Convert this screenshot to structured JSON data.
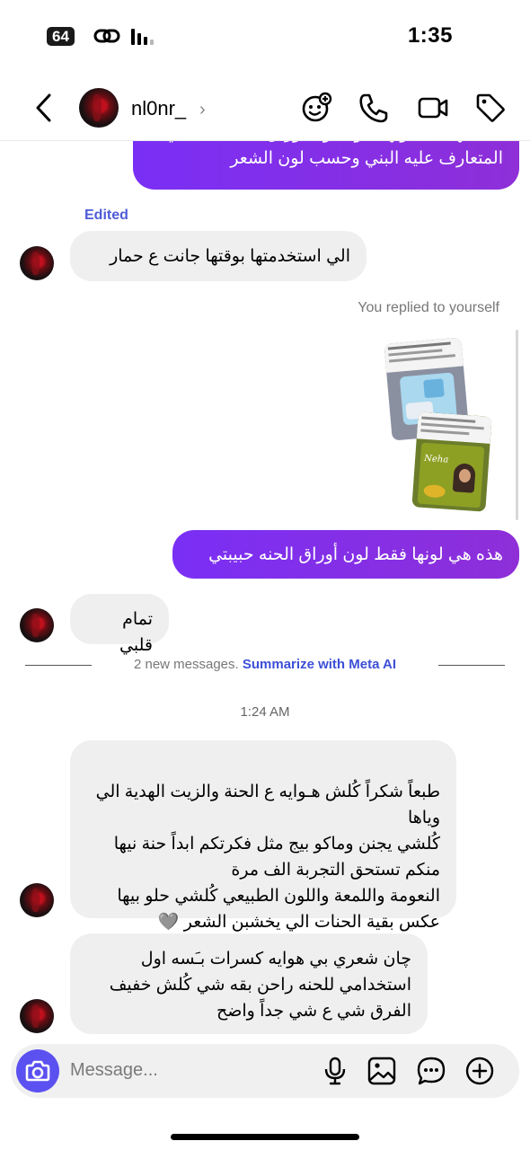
{
  "status_bar": {
    "time": "1:35",
    "badge": "64"
  },
  "header": {
    "username": "nl0nr_"
  },
  "messages": {
    "out_top": "حنه بيها هذه لونها يكون لون أوراق الحنه الطبيعي المتعارف عليه البني وحسب لون الشعر",
    "edited": "Edited",
    "in_1": "الي استخدمتها بوقتها جانت ع حمار",
    "replied": "You replied to yourself",
    "out_2": "هذه هي لونها فقط لون أوراق الحنه حبيبتي",
    "in_2": "تمام قلبي",
    "new_messages": "2 new messages.",
    "summarize": "Summarize with Meta AI",
    "timestamp": "1:24 AM",
    "in_3": "طبعاً شكراً كُلش هـوايه ع الحنة والزيت الهدية الي وياها\nكُلشي يجنن وماكو بيج مثل فكرتكم ابداً حنة نيها منكم تستحق التجربة الف مرة\nالنعومة واللمعة واللون الطبيعي كُلشي حلو بيها عكس بقية الحنات الي يخشبن الشعر 🩶",
    "in_4": "چان شعري بي هوايه كسرات بـَسه اول استخدامي للحنه راحن بقه شي كُلش خفيف الفرق شي ع شي جداً واضح"
  },
  "shared_image": {
    "label_top": "ارواح وشا",
    "brand": "Neha"
  },
  "composer": {
    "placeholder": "Message..."
  }
}
